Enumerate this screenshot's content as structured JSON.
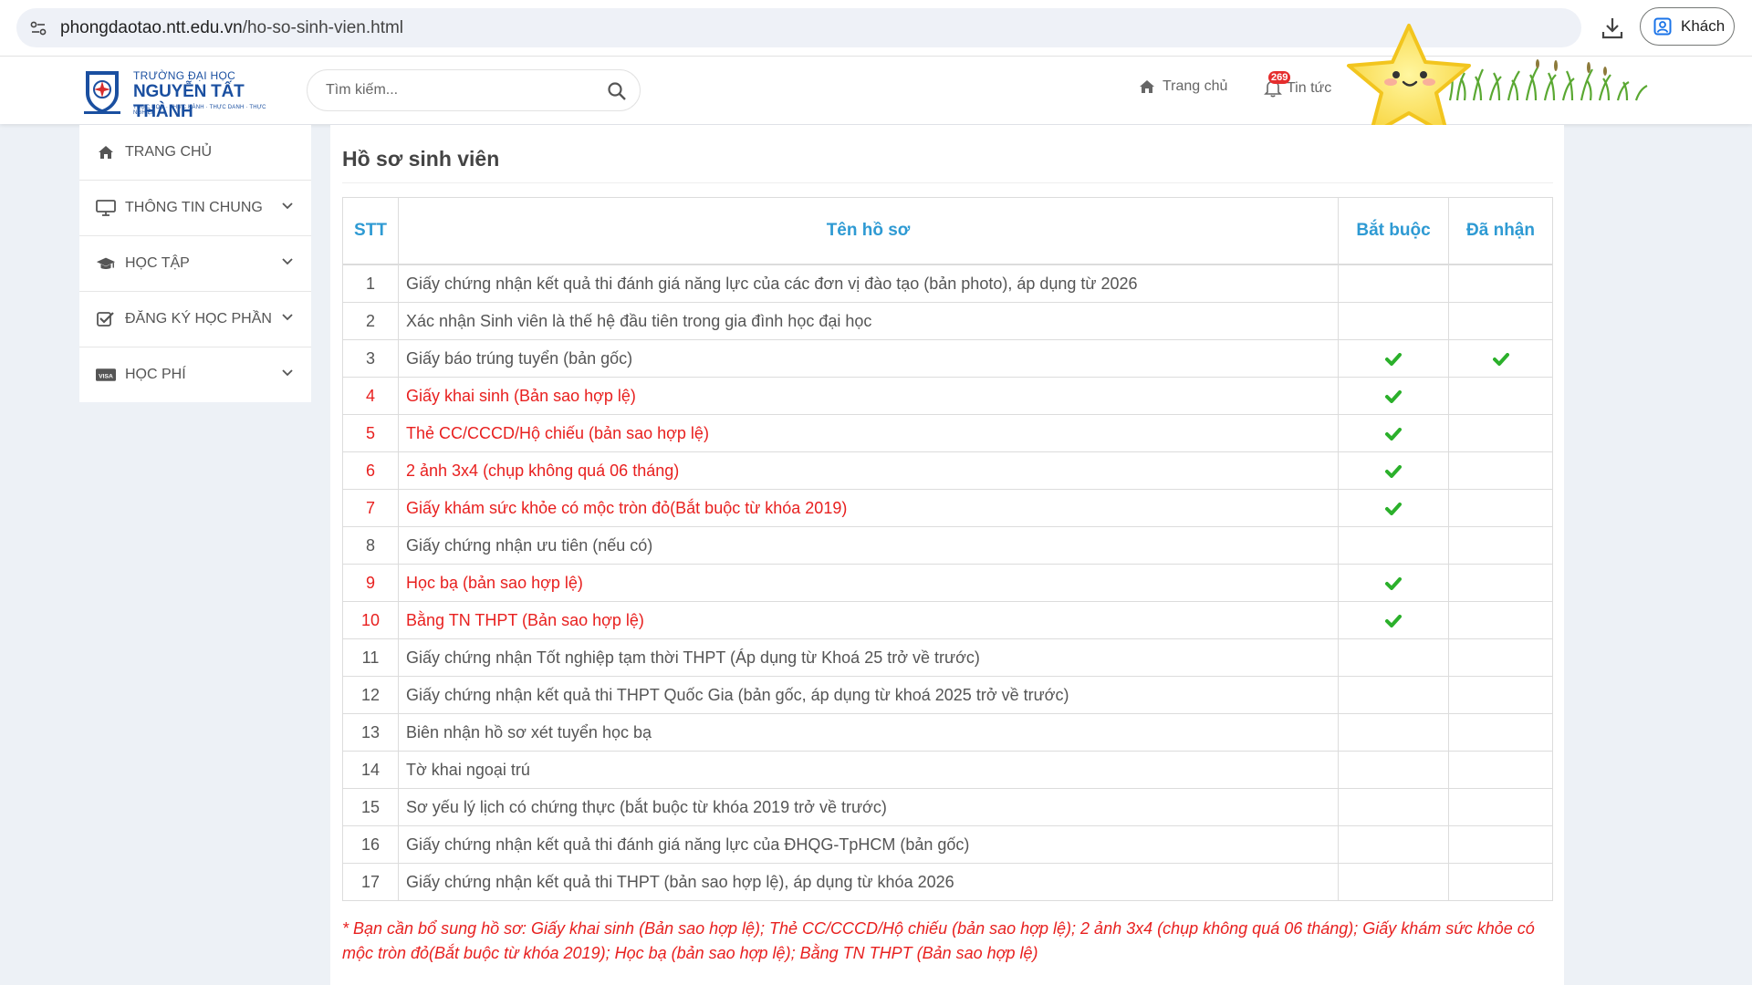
{
  "browser": {
    "url_host": "phongdaotao.ntt.edu.vn",
    "url_path": "/ho-so-sinh-vien.html",
    "profile_label": "Khách"
  },
  "header": {
    "logo_line1": "TRƯỜNG ĐẠI HỌC",
    "logo_line2": "NGUYỄN TẤT THÀNH",
    "logo_line3": "THỰC HỌC · THỰC HÀNH · THỰC DANH · THỰC NGHIỆP",
    "search_placeholder": "Tìm kiếm...",
    "nav_home": "Trang chủ",
    "nav_news": "Tin tức",
    "news_badge": "269"
  },
  "sidebar": {
    "items": [
      {
        "label": "TRANG CHỦ",
        "icon": "home-icon"
      },
      {
        "label": "THÔNG TIN CHUNG",
        "icon": "monitor-icon"
      },
      {
        "label": "HỌC TẬP",
        "icon": "graduation-cap-icon"
      },
      {
        "label": "ĐĂNG KÝ HỌC PHẦN",
        "icon": "checkbox-icon"
      },
      {
        "label": "HỌC PHÍ",
        "icon": "visa-card-icon"
      }
    ]
  },
  "main": {
    "title": "Hồ sơ sinh viên",
    "columns": {
      "stt": "STT",
      "name": "Tên hồ sơ",
      "required": "Bắt buộc",
      "received": "Đã nhận"
    },
    "rows": [
      {
        "stt": "1",
        "name": "Giấy chứng nhận kết quả thi đánh giá năng lực của các đơn vị đào tạo (bản photo), áp dụng từ 2026",
        "required": false,
        "received": false,
        "missing": false
      },
      {
        "stt": "2",
        "name": "Xác nhận Sinh viên là thế hệ đầu tiên trong gia đình học đại học",
        "required": false,
        "received": false,
        "missing": false
      },
      {
        "stt": "3",
        "name": "Giấy báo trúng tuyển (bản gốc)",
        "required": true,
        "received": true,
        "missing": false
      },
      {
        "stt": "4",
        "name": "Giấy khai sinh (Bản sao hợp lệ)",
        "required": true,
        "received": false,
        "missing": true
      },
      {
        "stt": "5",
        "name": "Thẻ CC/CCCD/Hộ chiếu (bản sao hợp lệ)",
        "required": true,
        "received": false,
        "missing": true
      },
      {
        "stt": "6",
        "name": "2 ảnh 3x4 (chụp không quá 06 tháng)",
        "required": true,
        "received": false,
        "missing": true
      },
      {
        "stt": "7",
        "name": "Giấy khám sức khỏe có mộc tròn đỏ(Bắt buộc từ khóa 2019)",
        "required": true,
        "received": false,
        "missing": true
      },
      {
        "stt": "8",
        "name": "Giấy chứng nhận ưu tiên (nếu có)",
        "required": false,
        "received": false,
        "missing": false
      },
      {
        "stt": "9",
        "name": "Học bạ (bản sao hợp lệ)",
        "required": true,
        "received": false,
        "missing": true
      },
      {
        "stt": "10",
        "name": "Bằng TN THPT (Bản sao hợp lệ)",
        "required": true,
        "received": false,
        "missing": true
      },
      {
        "stt": "11",
        "name": "Giấy chứng nhận Tốt nghiệp tạm thời THPT (Áp dụng từ Khoá 25 trở về trước)",
        "required": false,
        "received": false,
        "missing": false
      },
      {
        "stt": "12",
        "name": "Giấy chứng nhận kết quả thi THPT Quốc Gia (bản gốc, áp dụng từ khoá 2025 trở về trước)",
        "required": false,
        "received": false,
        "missing": false
      },
      {
        "stt": "13",
        "name": "Biên nhận hồ sơ xét tuyển học bạ",
        "required": false,
        "received": false,
        "missing": false
      },
      {
        "stt": "14",
        "name": "Tờ khai ngoại trú",
        "required": false,
        "received": false,
        "missing": false
      },
      {
        "stt": "15",
        "name": "Sơ yếu lý lịch có chứng thực (bắt buộc từ khóa 2019 trở về trước)",
        "required": false,
        "received": false,
        "missing": false
      },
      {
        "stt": "16",
        "name": "Giấy chứng nhận kết quả thi đánh giá năng lực của ĐHQG-TpHCM (bản gốc)",
        "required": false,
        "received": false,
        "missing": false
      },
      {
        "stt": "17",
        "name": "Giấy chứng nhận kết quả thi THPT (bản sao hợp lệ), áp dụng từ khóa 2026",
        "required": false,
        "received": false,
        "missing": false
      }
    ],
    "note": "* Bạn cần bổ sung hồ sơ: Giấy khai sinh (Bản sao hợp lệ); Thẻ CC/CCCD/Hộ chiếu (bản sao hợp lệ); 2 ảnh 3x4 (chụp không quá 06 tháng); Giấy khám sức khỏe có mộc tròn đỏ(Bắt buộc từ khóa 2019); Học bạ (bản sao hợp lệ); Bằng TN THPT (Bản sao hợp lệ)"
  },
  "colors": {
    "accent_blue": "#2e9ad3",
    "missing_red": "#e8201f",
    "check_green": "#2bb02b",
    "logo_blue": "#1a4fa0"
  }
}
